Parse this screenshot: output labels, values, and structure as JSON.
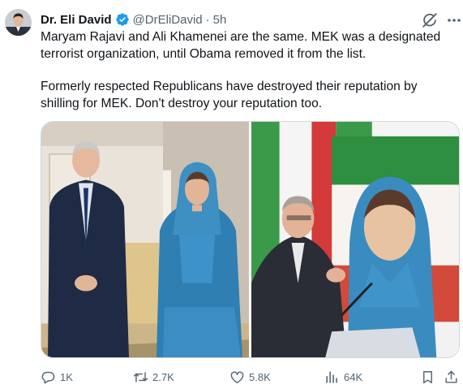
{
  "author": {
    "display_name": "Dr. Eli David",
    "handle": "@DrEliDavid",
    "separator": "·",
    "timestamp": "5h",
    "verified": true
  },
  "tweet": {
    "paragraphs": [
      "Maryam Rajavi and Ali Khamenei are the same. MEK was a designated terrorist organization, until Obama removed it from the list.",
      "Formerly respected Republicans have destroyed their reputation by shilling for MEK. Don't destroy your reputation too."
    ]
  },
  "media": {
    "count": 2
  },
  "actions": {
    "replies": "1K",
    "reposts": "2.7K",
    "likes": "5.8K",
    "views": "64K"
  },
  "icons": {
    "reply": "reply-icon",
    "repost": "repost-icon",
    "like": "heart-icon",
    "views": "views-icon",
    "bookmark": "bookmark-icon",
    "share": "share-icon",
    "grok": "grok-icon",
    "more": "more-icon",
    "verified": "verified-badge-icon"
  },
  "colors": {
    "text": "#0f1419",
    "secondary": "#536471",
    "verified": "#1d9bf0",
    "border": "#cfd9de"
  }
}
